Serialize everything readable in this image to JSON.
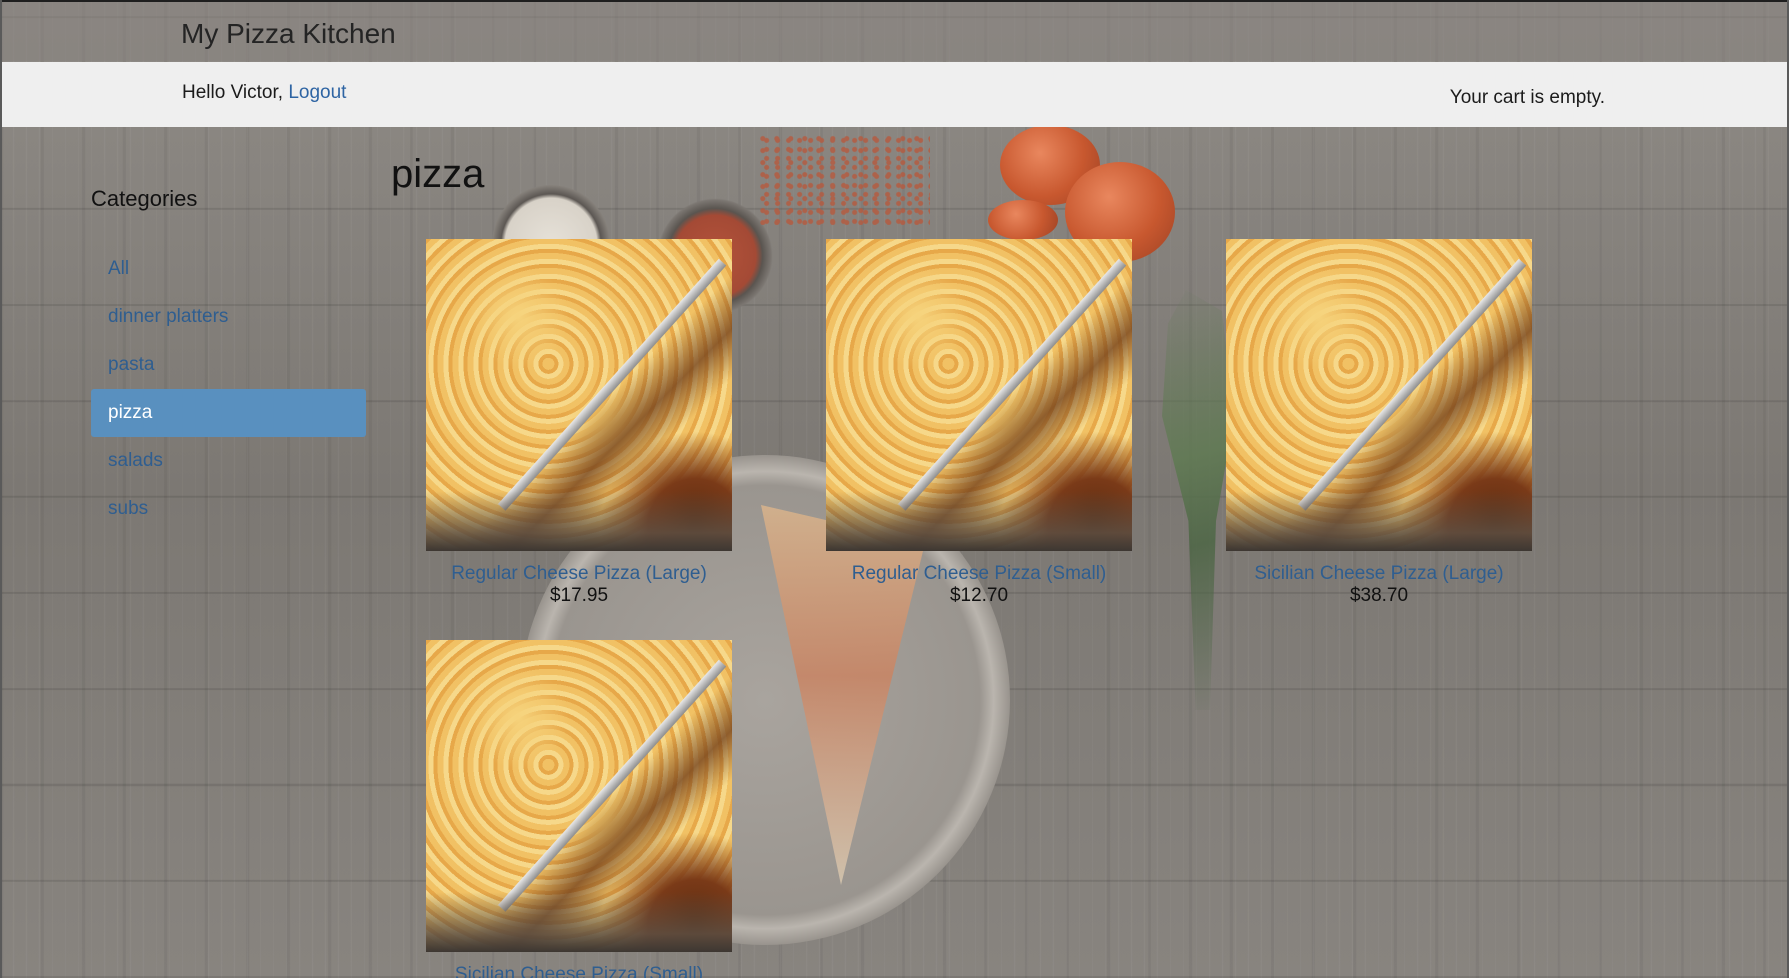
{
  "header": {
    "brand": "My Pizza Kitchen"
  },
  "userbar": {
    "greeting": "Hello Victor,",
    "logout_label": "Logout",
    "cart_status": "Your cart is empty."
  },
  "sidebar": {
    "heading": "Categories",
    "items": [
      {
        "label": "All",
        "active": false
      },
      {
        "label": "dinner platters",
        "active": false
      },
      {
        "label": "pasta",
        "active": false
      },
      {
        "label": "pizza",
        "active": true
      },
      {
        "label": "salads",
        "active": false
      },
      {
        "label": "subs",
        "active": false
      }
    ]
  },
  "main": {
    "title": "pizza",
    "products": [
      {
        "name": "Regular Cheese Pizza (Large)",
        "price": "$17.95"
      },
      {
        "name": "Regular Cheese Pizza (Small)",
        "price": "$12.70"
      },
      {
        "name": "Sicilian Cheese Pizza (Large)",
        "price": "$38.70"
      },
      {
        "name": "Sicilian Cheese Pizza (Small)",
        "price": ""
      }
    ]
  },
  "colors": {
    "link": "#2f5e90",
    "active_category_bg": "#5990bf",
    "userbar_bg": "#efefef"
  }
}
